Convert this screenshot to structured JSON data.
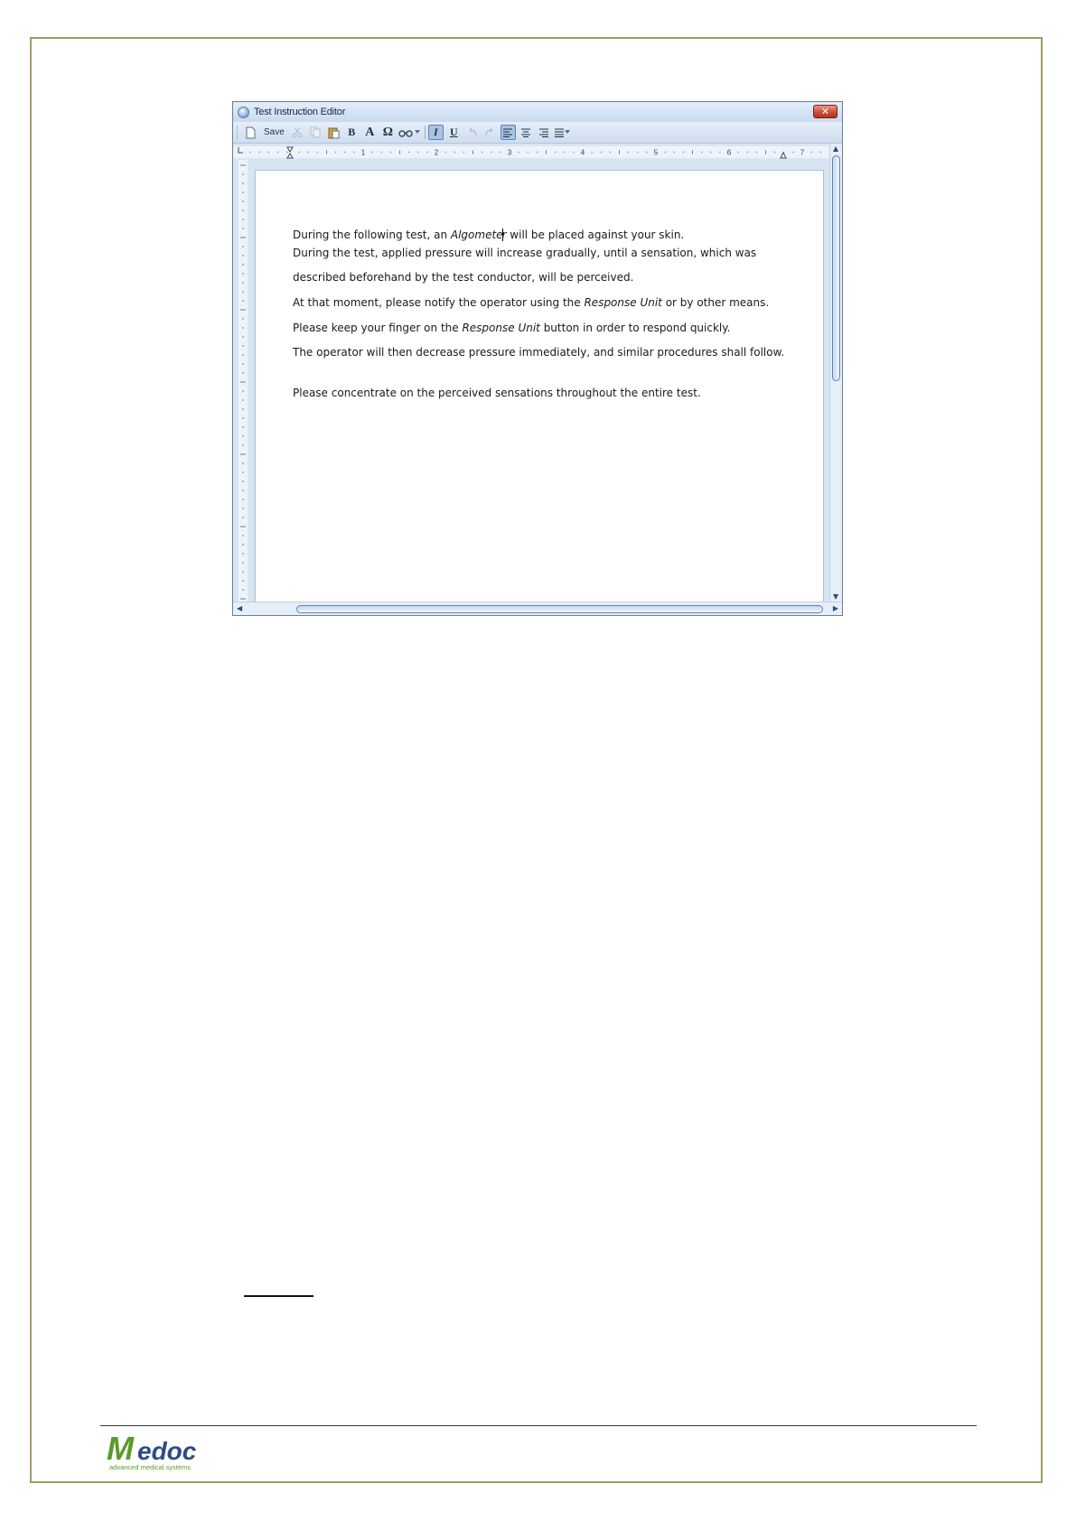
{
  "window": {
    "title": "Test Instruction Editor",
    "close_glyph": "✕"
  },
  "toolbar": {
    "save_label": "Save",
    "bold_label": "B",
    "font_label": "A",
    "symbol_label": "Ω",
    "italic_label": "I",
    "underline_label": "U",
    "active_buttons": [
      "italic",
      "align-left"
    ]
  },
  "ruler": {
    "numbers": [
      "1",
      "2",
      "3",
      "4",
      "5",
      "6",
      "7"
    ]
  },
  "document": {
    "line1_before": "During the following test, an ",
    "line1_italic_a": "Algomete",
    "line1_italic_b": "r",
    "line1_after": " will be placed against your skin.",
    "line2": "During the test, applied pressure will increase gradually, until a sensation, which was",
    "line3": "described beforehand by the test conductor, will be perceived.",
    "line4_before": "At that moment, please notify the operator using the ",
    "line4_italic": "Response Unit",
    "line4_after": " or by other means.",
    "line5_before": "Please keep your finger on the ",
    "line5_italic": "Response Unit",
    "line5_after": " button in order to respond quickly.",
    "line6": "The operator will then decrease pressure immediately, and similar procedures shall follow.",
    "line7": "Please concentrate on the perceived sensations throughout the entire test."
  },
  "footer": {
    "logo_text": "Medoc",
    "logo_tagline": "advanced medical systems",
    "logo_color": "#5a9a2a"
  }
}
